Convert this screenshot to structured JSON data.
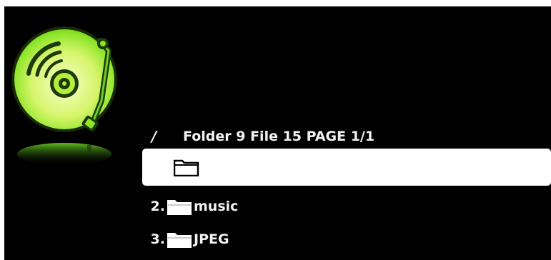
{
  "browser": {
    "path": "/",
    "summary": "Folder 9 File 15 PAGE 1/1"
  },
  "items": [
    {
      "number": "",
      "name": "",
      "selected": true
    },
    {
      "number": "2.",
      "name": "music",
      "selected": false
    },
    {
      "number": "3.",
      "name": "JPEG",
      "selected": false
    }
  ],
  "icons": {
    "logo": "music-disc-turntable-icon",
    "item": "folder-icon"
  },
  "colors": {
    "background": "#000000",
    "text": "#f2f2f2",
    "accent_green": "#7cff2a",
    "selection": "#ffffff"
  }
}
